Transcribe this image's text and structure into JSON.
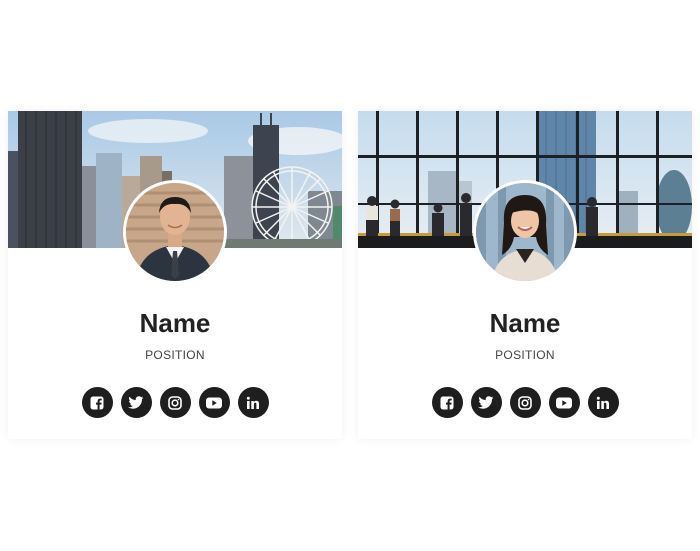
{
  "cards": [
    {
      "name": "Name",
      "position": "POSITION",
      "cover": "city-skyline-with-ferris-wheel",
      "avatar": "man-in-suit-portrait"
    },
    {
      "name": "Name",
      "position": "POSITION",
      "cover": "glass-office-interior",
      "avatar": "smiling-woman-portrait"
    }
  ],
  "social_icons": [
    "facebook-icon",
    "twitter-icon",
    "instagram-icon",
    "youtube-icon",
    "linkedin-icon"
  ],
  "colors": {
    "icon_bg": "#1e1e1e",
    "name_text": "#222222",
    "position_text": "#444444",
    "card_bg": "#ffffff"
  }
}
